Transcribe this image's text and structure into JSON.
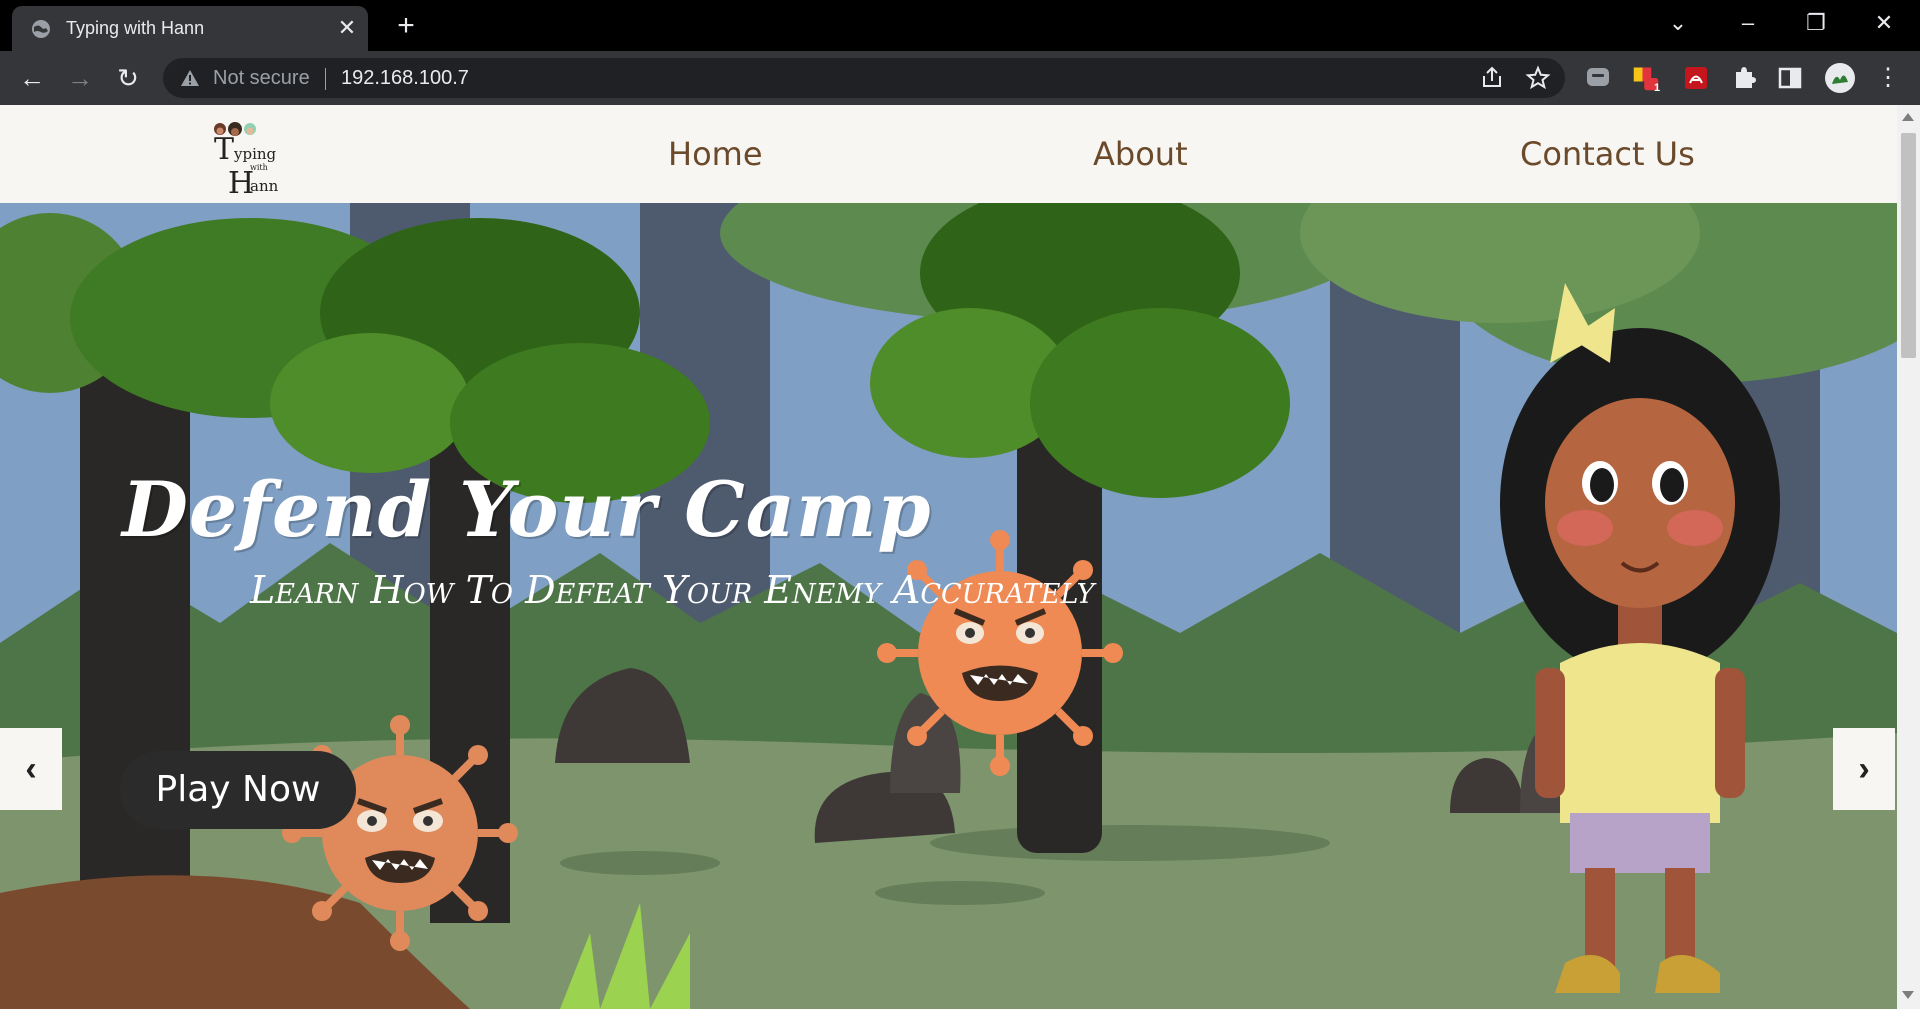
{
  "browser": {
    "tab_title": "Typing with Hann",
    "security_label": "Not secure",
    "url": "192.168.100.7",
    "extension_badge": "1"
  },
  "site": {
    "logo_text": "Typing with Hann",
    "nav": {
      "home": "Home",
      "about": "About",
      "contact": "Contact Us"
    }
  },
  "hero": {
    "title": "Defend Your Camp",
    "subtitle": "Learn How To Defeat Your Enemy Accurately",
    "cta_label": "Play Now",
    "prev_label": "‹",
    "next_label": "›"
  },
  "colors": {
    "nav_text": "#6b4a2b",
    "sky": "#7f9fc4",
    "ground": "#7e946d",
    "cta_bg": "#2b2b2b"
  }
}
